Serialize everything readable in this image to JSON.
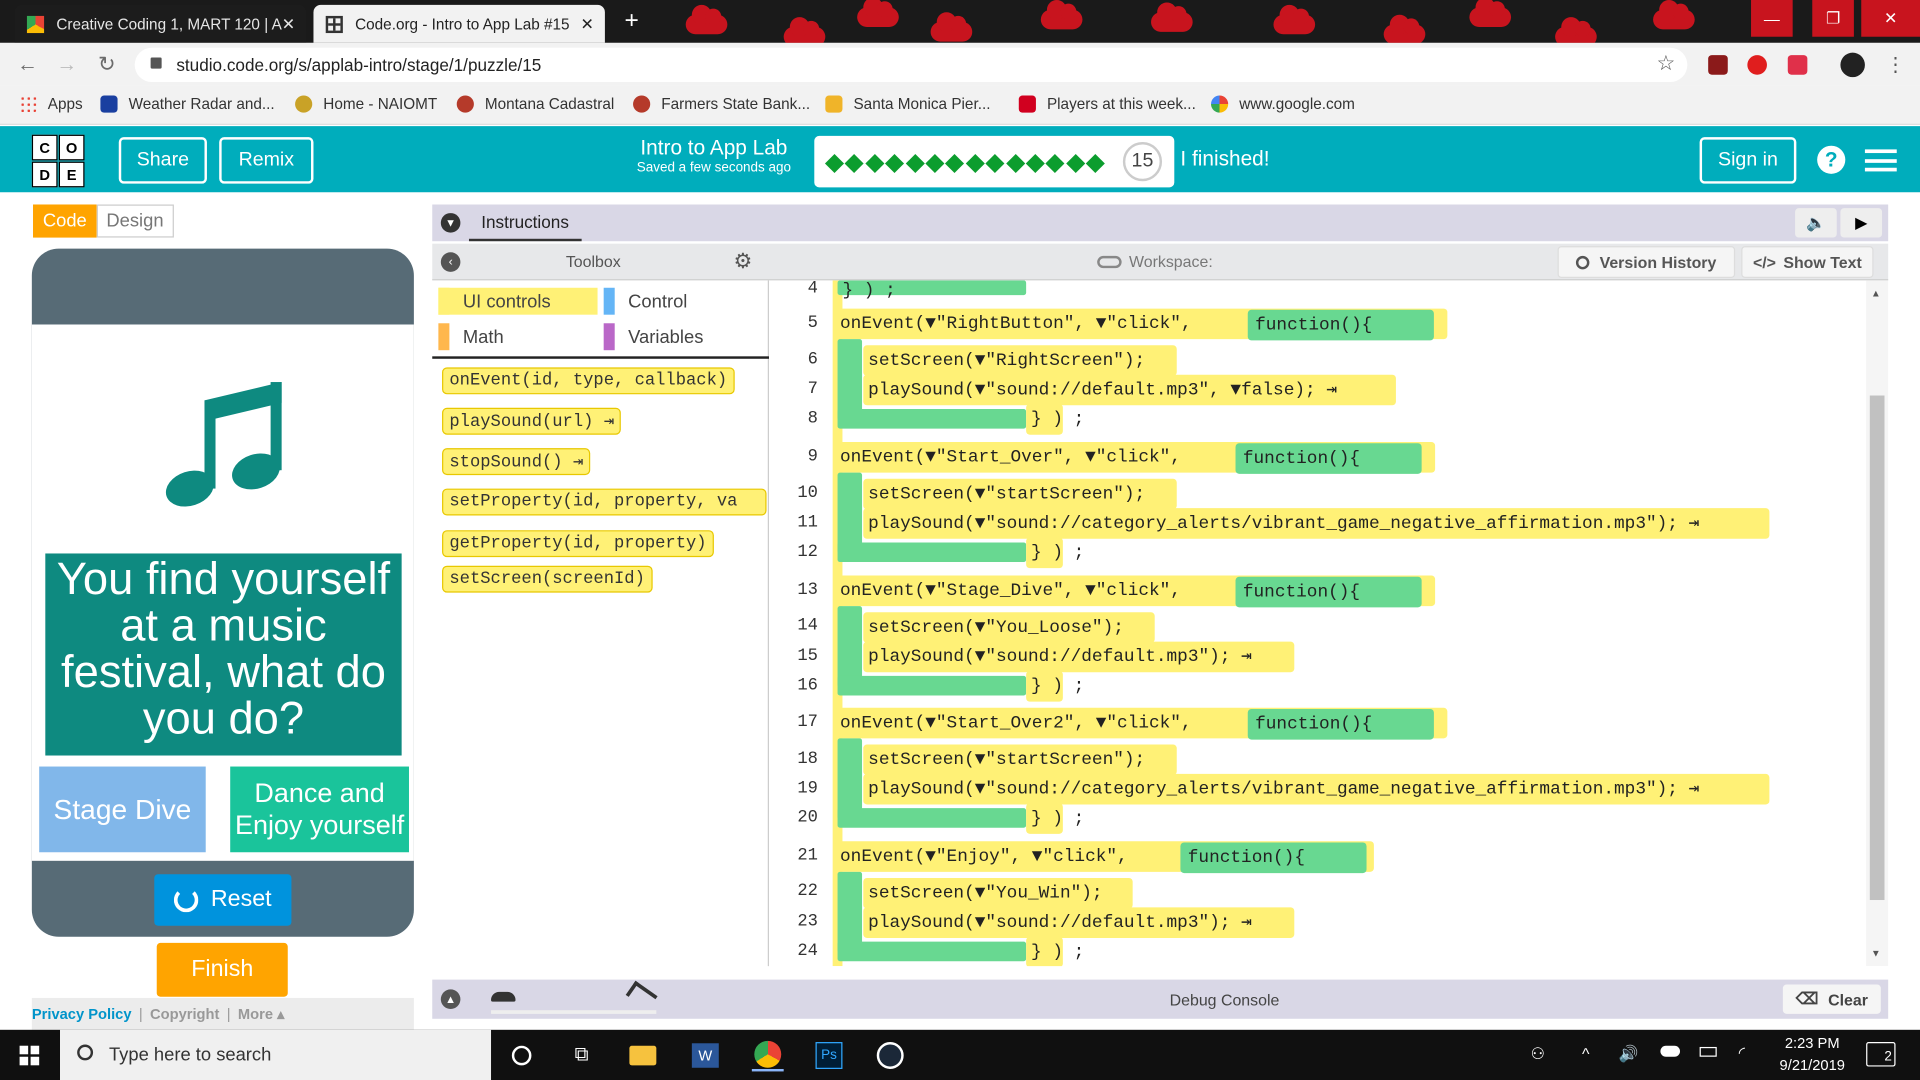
{
  "browser": {
    "tabs": [
      {
        "label": "Creative Coding 1, MART 120 | A",
        "active": false
      },
      {
        "label": "Code.org - Intro to App Lab #15",
        "active": true
      }
    ],
    "new_tab": "+",
    "url": "studio.code.org/s/applab-intro/stage/1/puzzle/15",
    "bookmarks": [
      "Apps",
      "Weather Radar and...",
      "Home - NAIOMT",
      "Montana Cadastral",
      "Farmers State Bank...",
      "Santa Monica Pier...",
      "Players at this week...",
      "www.google.com"
    ],
    "icons": {
      "back": "back-arrow-icon",
      "forward": "forward-arrow-icon",
      "reload": "reload-icon",
      "lock": "lock-icon",
      "star": "star-icon"
    }
  },
  "header": {
    "logo_letters": [
      "C",
      "O",
      "D",
      "E"
    ],
    "share": "Share",
    "remix": "Remix",
    "title": "Intro to App Lab",
    "subtitle": "Saved a few seconds ago",
    "completed_dots": 14,
    "level": "15",
    "finished": "I finished!",
    "sign_in": "Sign in",
    "help": "?"
  },
  "left": {
    "mode_code": "Code",
    "mode_design": "Design",
    "story_text": "You find yourself at a music festival, what do you do?",
    "btn_stage_dive": "Stage Dive",
    "btn_dance": "Dance and Enjoy yourself",
    "reset": "Reset",
    "finish": "Finish",
    "footer": {
      "privacy": "Privacy Policy",
      "sep": "|",
      "copyright": "Copyright",
      "more": "More ▴"
    }
  },
  "instructions": {
    "tab": "Instructions"
  },
  "toolbox": {
    "title": "Toolbox",
    "categories": [
      {
        "label": "UI controls",
        "color": "#fff176",
        "selected": true
      },
      {
        "label": "Control",
        "color": "#64b5f6",
        "selected": false
      },
      {
        "label": "Math",
        "color": "#ffb74d",
        "selected": false
      },
      {
        "label": "Variables",
        "color": "#ba68c8",
        "selected": false
      }
    ],
    "blocks": [
      "onEvent(id, type, callback)",
      "playSound(url) ⇥",
      "stopSound() ⇥",
      "setProperty(id, property, va",
      "getProperty(id, property)",
      "setScreen(screenId)"
    ]
  },
  "workspace": {
    "title": "Workspace:",
    "version_history": "Version History",
    "show_text": "Show Text",
    "line_numbers": [
      "4",
      "5",
      "6",
      "7",
      "8",
      "9",
      "10",
      "11",
      "12",
      "13",
      "14",
      "15",
      "16",
      "17",
      "18",
      "19",
      "20",
      "21",
      "22",
      "23",
      "24"
    ],
    "lines": {
      "l4": "} ) ;",
      "l5a": "onEvent(▼\"RightButton\", ▼\"click\",",
      "l5b": "function(){",
      "l6": "setScreen(▼\"RightScreen\");",
      "l7": "playSound(▼\"sound://default.mp3\", ▼false); ⇥",
      "l8": "} ) ;",
      "l9a": "onEvent(▼\"Start_Over\", ▼\"click\",",
      "l9b": "function(){",
      "l10": "setScreen(▼\"startScreen\");",
      "l11": "playSound(▼\"sound://category_alerts/vibrant_game_negative_affirmation.mp3\"); ⇥",
      "l12": "} ) ;",
      "l13a": "onEvent(▼\"Stage_Dive\", ▼\"click\",",
      "l13b": "function(){",
      "l14": "setScreen(▼\"You_Loose\");",
      "l15": "playSound(▼\"sound://default.mp3\"); ⇥",
      "l16": "} ) ;",
      "l17a": "onEvent(▼\"Start_Over2\", ▼\"click\",",
      "l17b": "function(){",
      "l18": "setScreen(▼\"startScreen\");",
      "l19": "playSound(▼\"sound://category_alerts/vibrant_game_negative_affirmation.mp3\"); ⇥",
      "l20": "} ) ;",
      "l21a": "onEvent(▼\"Enjoy\", ▼\"click\",",
      "l21b": "function(){",
      "l22": "setScreen(▼\"You_Win\");",
      "l23": "playSound(▼\"sound://default.mp3\"); ⇥",
      "l24": "} ) ;"
    }
  },
  "debug": {
    "title": "Debug Console",
    "clear": "Clear"
  },
  "taskbar": {
    "search_placeholder": "Type here to search",
    "time": "2:23 PM",
    "date": "9/21/2019",
    "notifications": "2"
  }
}
